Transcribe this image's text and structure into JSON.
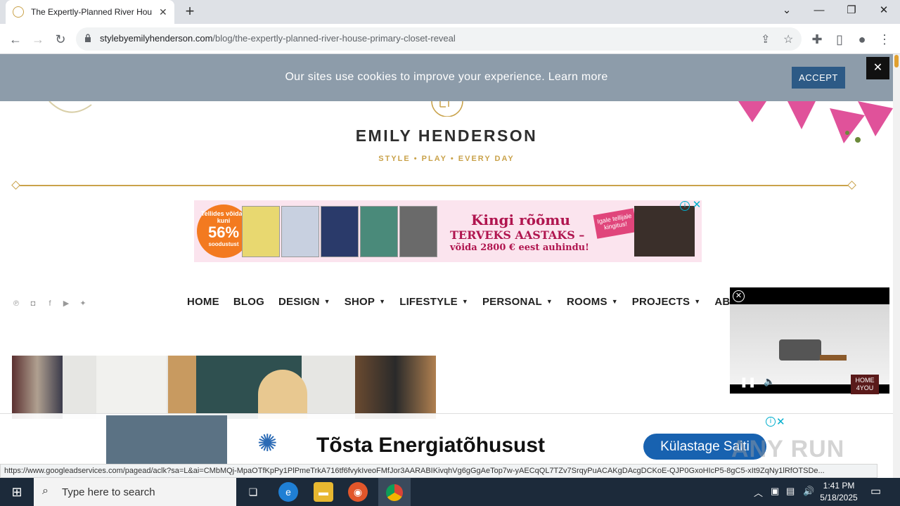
{
  "browser": {
    "tab_title": "The Expertly-Planned River Hou",
    "url_host": "stylebyemilyhenderson.com",
    "url_path": "/blog/the-expertly-planned-river-house-primary-closet-reveal"
  },
  "cookie_bar": {
    "text": "Our sites use cookies to improve your experience.",
    "learn_more": "Learn more",
    "accept": "ACCEPT",
    "close": "✕"
  },
  "header": {
    "brand": "EMILY HENDERSON",
    "tagline": "STYLE  •  PLAY  •  EVERY DAY"
  },
  "top_ad": {
    "badge_small": "Tellides võidad kuni",
    "badge_percent": "56%",
    "badge_tail": "soodustust",
    "headline1": "Kingi rõõmu",
    "headline2": "TERVEKS AASTAKS –",
    "headline3": "võida 2800 € eest auhindu!",
    "tag": "Igale tellijale kingitus!"
  },
  "nav": {
    "items": [
      {
        "label": "HOME",
        "dropdown": false
      },
      {
        "label": "BLOG",
        "dropdown": false
      },
      {
        "label": "DESIGN",
        "dropdown": true
      },
      {
        "label": "SHOP",
        "dropdown": true
      },
      {
        "label": "LIFESTYLE",
        "dropdown": true
      },
      {
        "label": "PERSONAL",
        "dropdown": true
      },
      {
        "label": "ROOMS",
        "dropdown": true
      },
      {
        "label": "PROJECTS",
        "dropdown": true
      },
      {
        "label": "AB",
        "dropdown": false
      }
    ]
  },
  "video_ad": {
    "logo": "HOME 4YOU"
  },
  "bottom_ad": {
    "headline": "Tõsta Energiatõhusust",
    "cta": "Külastage Saiti"
  },
  "status_url": "https://www.googleadservices.com/pagead/aclk?sa=L&ai=CMbMQj-MpaOTfKpPy1PlPmeTrkA716tf6fvykIveoFMfJor3AARABIKivqhVg6gGgAeTop7w-yAECqQL7TZv7SrqyPuACAKgDAcgDCKoE-QJP0GxoHIcP5-8gC5-xIt9ZqNy1lRfOTSDe...",
  "watermark": "ANY RUN",
  "taskbar": {
    "search_placeholder": "Type here to search",
    "time": "1:41 PM",
    "date": "5/18/2025"
  },
  "colors": {
    "gold": "#c9a24a",
    "cookie_bg": "#8d9caa",
    "accept_bg": "#2d5a86",
    "cta_blue": "#1862b0"
  }
}
